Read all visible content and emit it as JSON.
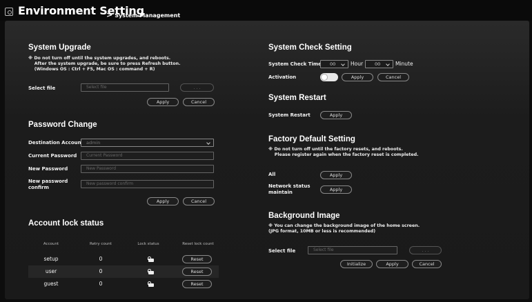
{
  "header": {
    "title": "Environment Setting",
    "subtitle": "System Management",
    "icon": "gear-icon"
  },
  "upgrade": {
    "title": "System Upgrade",
    "note": "※ Do not turn off until the system upgrades, and reboots.\n    After the system upgrade, be sure to press Refresh button.\n    (Windows OS : Ctrl + F5, Mac OS : command + R)",
    "select_label": "Select file",
    "file_placeholder": "Select file",
    "browse_label": ". . .",
    "apply": "Apply",
    "cancel": "Cancel"
  },
  "password": {
    "title": "Password Change",
    "dest_label": "Destination Account",
    "dest_value": "admin",
    "current_label": "Current Password",
    "current_placeholder": "Current Password",
    "new_label": "New Password",
    "new_placeholder": "New Password",
    "confirm_label": "New password\nconfirm",
    "confirm_placeholder": "New password confirm",
    "apply": "Apply",
    "cancel": "Cancel"
  },
  "lock": {
    "title": "Account lock status",
    "headers": [
      "Account",
      "Retry count",
      "Lock status",
      "Reset lock count"
    ],
    "rows": [
      {
        "account": "setup",
        "retry": "0",
        "reset": "Reset"
      },
      {
        "account": "user",
        "retry": "0",
        "reset": "Reset"
      },
      {
        "account": "guest",
        "retry": "0",
        "reset": "Reset"
      }
    ]
  },
  "check": {
    "title": "System Check Setting",
    "time_label": "System Check Time",
    "hour_value": "00",
    "hour_unit": "Hour",
    "minute_value": "00",
    "minute_unit": "Minute",
    "activation_label": "Activation",
    "activation_on": true,
    "apply": "Apply",
    "cancel": "Cancel"
  },
  "restart": {
    "title": "System Restart",
    "label": "System Restart",
    "apply": "Apply"
  },
  "factory": {
    "title": "Factory Default Setting",
    "note": "※ Do not turn off until the factory resets, and reboots.\n    Please register again when the factory reset is completed.",
    "all_label": "All",
    "network_label": "Network status\nmaintain",
    "apply_all": "Apply",
    "apply_network": "Apply"
  },
  "background": {
    "title": "Background Image",
    "note": "※ You can change the background image of the home screen.\n(JPG format, 10MB or less is recommended)",
    "select_label": "Select file",
    "file_placeholder": "Select file",
    "browse_label": ". . .",
    "initialize": "Initialize",
    "apply": "Apply",
    "cancel": "Cancel"
  }
}
